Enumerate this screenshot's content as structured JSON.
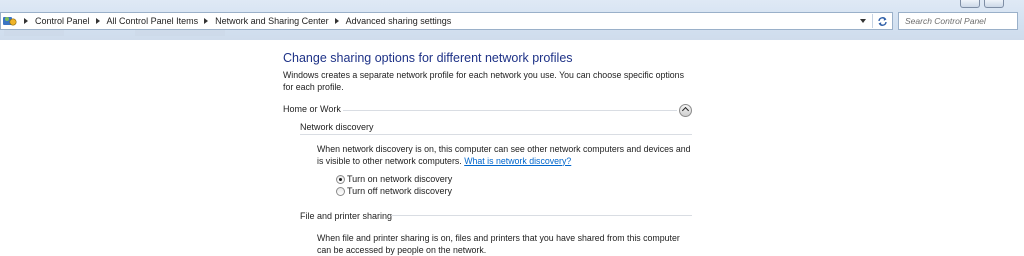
{
  "addressbar": {
    "breadcrumbs": [
      "Control Panel",
      "All Control Panel Items",
      "Network and Sharing Center",
      "Advanced sharing settings"
    ],
    "search_placeholder": "Search Control Panel"
  },
  "page": {
    "title": "Change sharing options for different network profiles",
    "intro": "Windows creates a separate network profile for each network you use. You can choose specific options for each profile.",
    "profile": {
      "name": "Home or Work",
      "expanded": true,
      "sections": [
        {
          "title": "Network discovery",
          "description": "When network discovery is on, this computer can see other network computers and devices and is visible to other network computers.",
          "link": "What is network discovery?",
          "options": [
            {
              "label": "Turn on network discovery",
              "selected": true
            },
            {
              "label": "Turn off network discovery",
              "selected": false
            }
          ]
        },
        {
          "title": "File and printer sharing",
          "description": "When file and printer sharing is on, files and printers that you have shared from this computer can be accessed by people on the network."
        }
      ]
    }
  }
}
